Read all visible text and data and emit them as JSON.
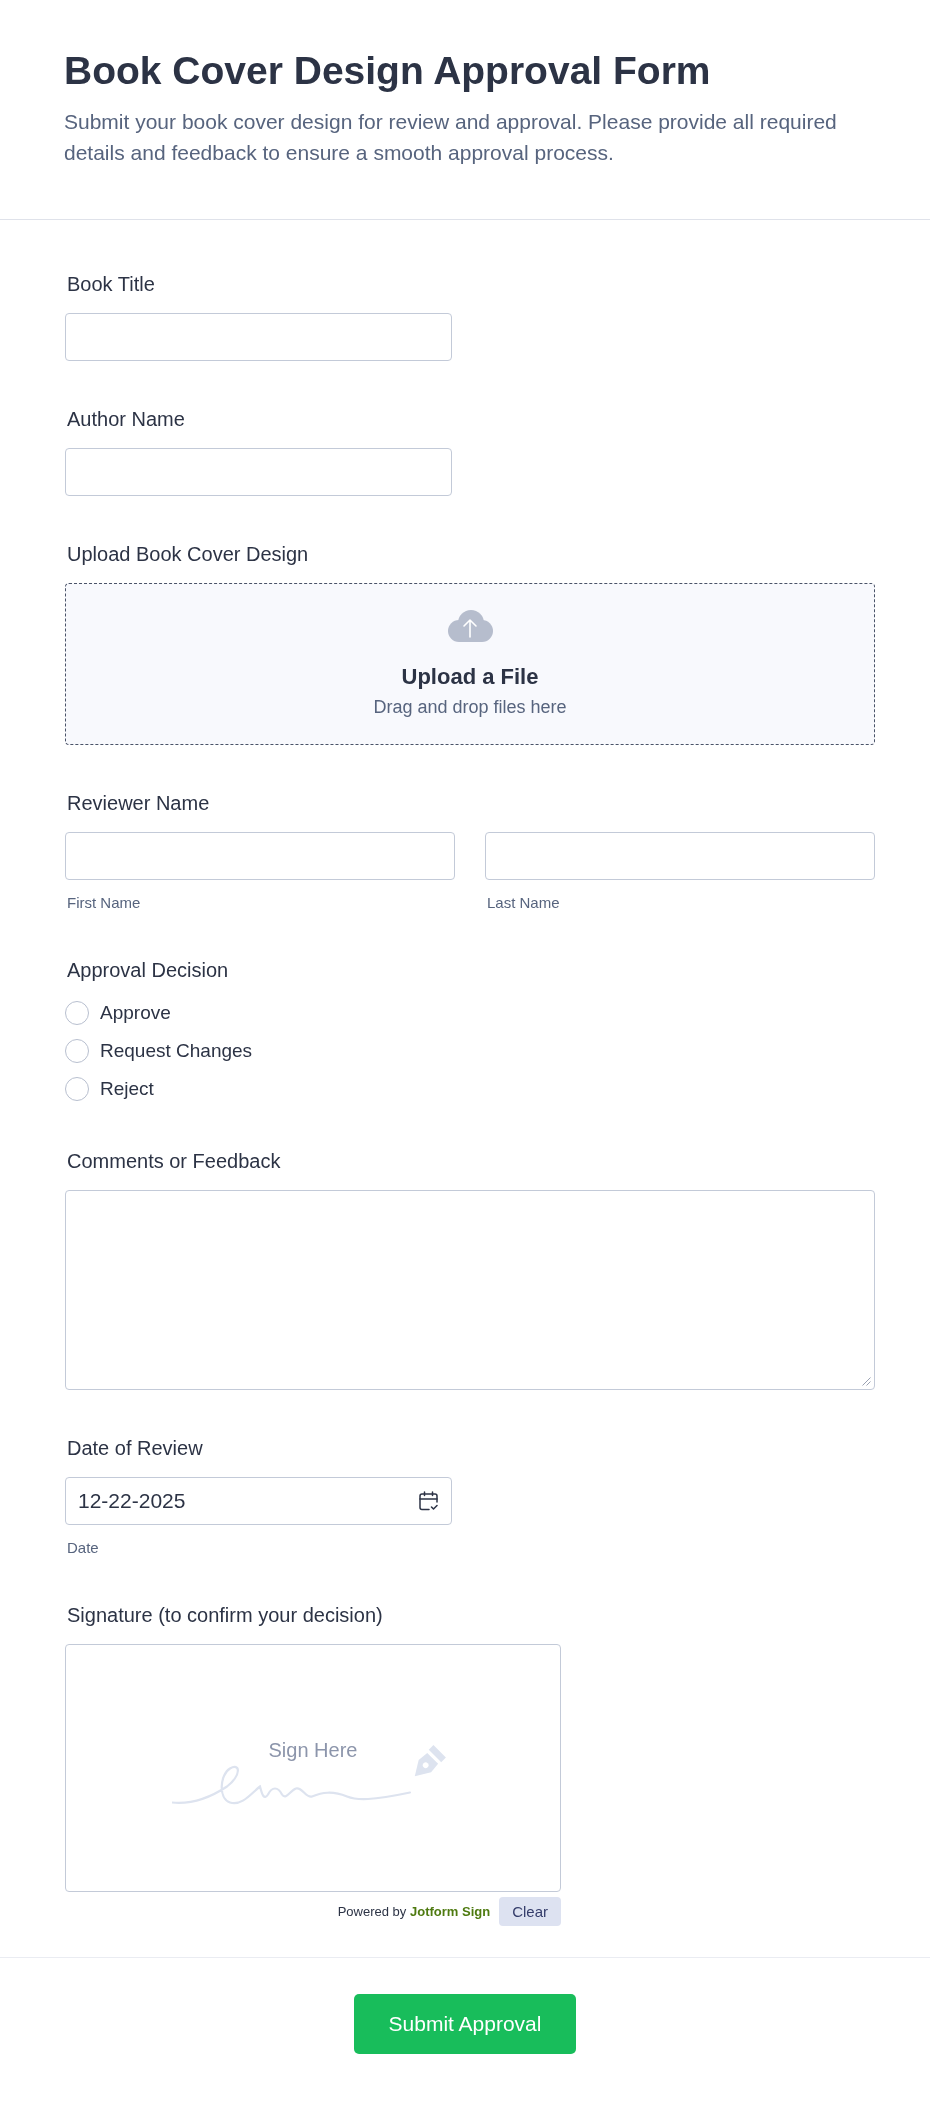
{
  "header": {
    "title": "Book Cover Design Approval Form",
    "description": "Submit your book cover design for review and approval. Please provide all required details and feedback to ensure a smooth approval process."
  },
  "fields": [
    {
      "kind": "text",
      "label": "Book Title"
    },
    {
      "kind": "text",
      "label": "Author Name"
    },
    {
      "kind": "upload",
      "label": "Upload Book Cover Design",
      "button_text": "Upload a File",
      "hint": "Drag and drop files here"
    },
    {
      "kind": "name",
      "label": "Reviewer Name",
      "sublabels": [
        "First Name",
        "Last Name"
      ]
    },
    {
      "kind": "radio",
      "label": "Approval Decision",
      "options": [
        {
          "label": "Approve",
          "selected": false
        },
        {
          "label": "Request Changes",
          "selected": false
        },
        {
          "label": "Reject",
          "selected": false
        }
      ]
    },
    {
      "kind": "textarea",
      "label": "Comments or Feedback"
    },
    {
      "kind": "date",
      "label": "Date of Review",
      "value": "12-22-2025",
      "sublabel": "Date"
    },
    {
      "kind": "signature",
      "label": "Signature (to confirm your decision)",
      "placeholder": "Sign Here",
      "powered_by": "Powered by **Jotform Sign**",
      "clear_button": "Clear"
    }
  ],
  "submit_button": "Submit Approval"
}
